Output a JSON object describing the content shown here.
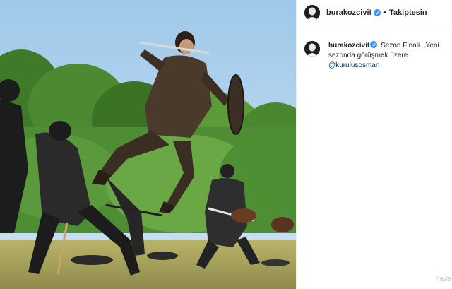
{
  "post": {
    "username": "burakozcivit",
    "header_separator": "•",
    "follow_label": "Takiptesin",
    "caption_text": "Sezon Finali...Yeni sezonda görüşmek üzere",
    "mention": "@kurulusosman",
    "verified_icon": "verified-badge-icon",
    "accent_color": "#3897f0"
  },
  "watermark": "Payla"
}
